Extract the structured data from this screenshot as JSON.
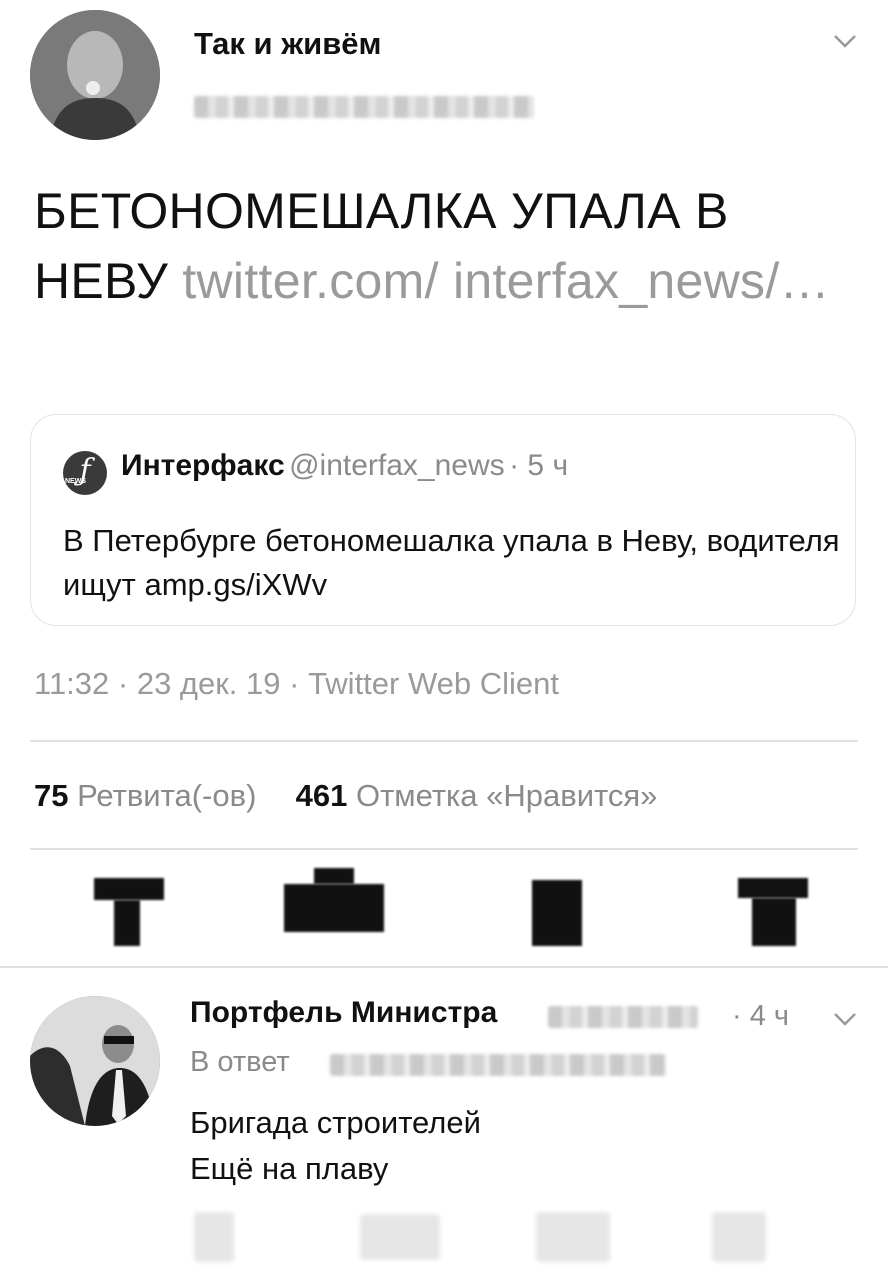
{
  "tweet": {
    "author_name": "Так и живём",
    "body_text": "БЕТОНОМЕШАЛКА УПАЛА В НЕВУ",
    "body_link": "twitter.com/ interfax_news/…",
    "timestamp_line": "11:32 · 23 дек. 19 · Twitter Web Client",
    "retweets_count": "75",
    "retweets_label": "Ретвита(-ов)",
    "likes_count": "461",
    "likes_label": "Отметка «Нравится»"
  },
  "quote": {
    "logo_glyph": "ƒ",
    "logo_caption": "NEWS",
    "author_name": "Интерфакс",
    "handle": "@interfax_news",
    "time": "· 5 ч",
    "text": "В Петербурге бетономешалка упала в Неву, водителя ищут amp.gs/iXWv"
  },
  "reply": {
    "author_name": "Портфель Министра",
    "time": "· 4 ч",
    "in_reply_prefix": "В ответ",
    "line1": "Бригада строителей",
    "line2": "Ещё на плаву"
  },
  "icons": {
    "more": "chevron-down-icon",
    "actions": [
      "reply-icon",
      "retweet-icon",
      "like-icon",
      "share-icon"
    ]
  },
  "colors": {
    "text": "#111111",
    "muted": "#8a8a8a",
    "border": "#e3e3e3"
  }
}
